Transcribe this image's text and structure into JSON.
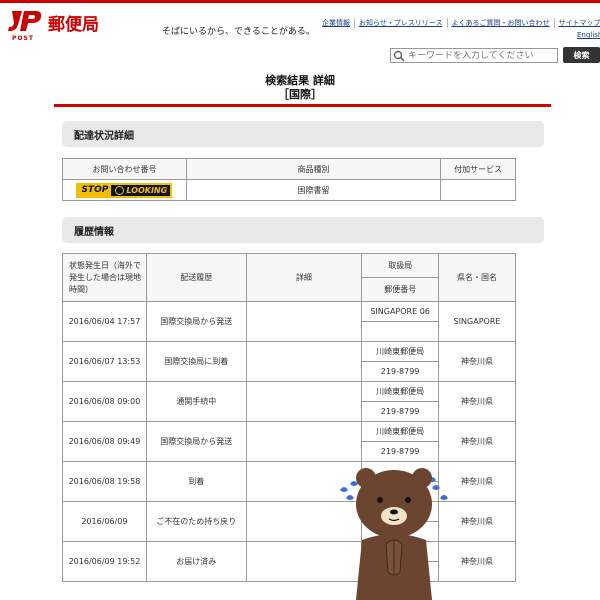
{
  "header": {
    "logo_mark": "JP",
    "logo_post": "POST",
    "logo_text": "郵便局",
    "tagline": "そばにいるから、できることがある。",
    "nav": [
      "企業情報",
      "お知らせ・プレスリリース",
      "よくあるご質問・お問い合わせ",
      "サイトマップ"
    ],
    "english": "English",
    "search_placeholder": "キーワードを入力してください",
    "search_button": "検索",
    "icon": "search-icon"
  },
  "title": {
    "line1": "検索結果 詳細",
    "line2": "［国際］"
  },
  "section1": {
    "heading": "配達状況詳細",
    "headers": [
      "お問い合わせ番号",
      "商品種別",
      "付加サービス"
    ],
    "banner_left": "STOP",
    "banner_right": "LOOKING",
    "product_type": "国際書留",
    "extra_service": ""
  },
  "section2": {
    "heading": "履歴情報",
    "headers": {
      "date": "状態発生日（海外で発生した場合は現地時間）",
      "status": "配送履歴",
      "detail": "詳細",
      "office": "取扱局",
      "postcode": "郵便番号",
      "region": "県名・国名"
    },
    "rows": [
      {
        "date": "2016/06/04 17:57",
        "status": "国際交換局から発送",
        "detail": "",
        "office": "SINGAPORE 06",
        "postcode": "",
        "region": "SINGAPORE"
      },
      {
        "date": "2016/06/07 13:53",
        "status": "国際交換局に到着",
        "detail": "",
        "office": "川崎東郵便局",
        "postcode": "219-8799",
        "region": "神奈川県"
      },
      {
        "date": "2016/06/08 09:00",
        "status": "通関手続中",
        "detail": "",
        "office": "川崎東郵便局",
        "postcode": "219-8799",
        "region": "神奈川県"
      },
      {
        "date": "2016/06/08 09:49",
        "status": "国際交換局から発送",
        "detail": "",
        "office": "川崎東郵便局",
        "postcode": "219-8799",
        "region": "神奈川県"
      },
      {
        "date": "2016/06/08 19:58",
        "status": "到着",
        "detail": "",
        "office": "",
        "postcode": "",
        "region": "神奈川県"
      },
      {
        "date": "2016/06/09",
        "status": "ご不在のため持ち戻り",
        "detail": "",
        "office": "",
        "postcode": "",
        "region": "神奈川県"
      },
      {
        "date": "2016/06/09 19:52",
        "status": "お届け済み",
        "detail": "",
        "office": "",
        "postcode": "",
        "region": "神奈川県"
      }
    ]
  },
  "colors": {
    "brand_red": "#cc0000",
    "banner_yellow": "#f0c000",
    "bear_brown": "#6b4530"
  }
}
